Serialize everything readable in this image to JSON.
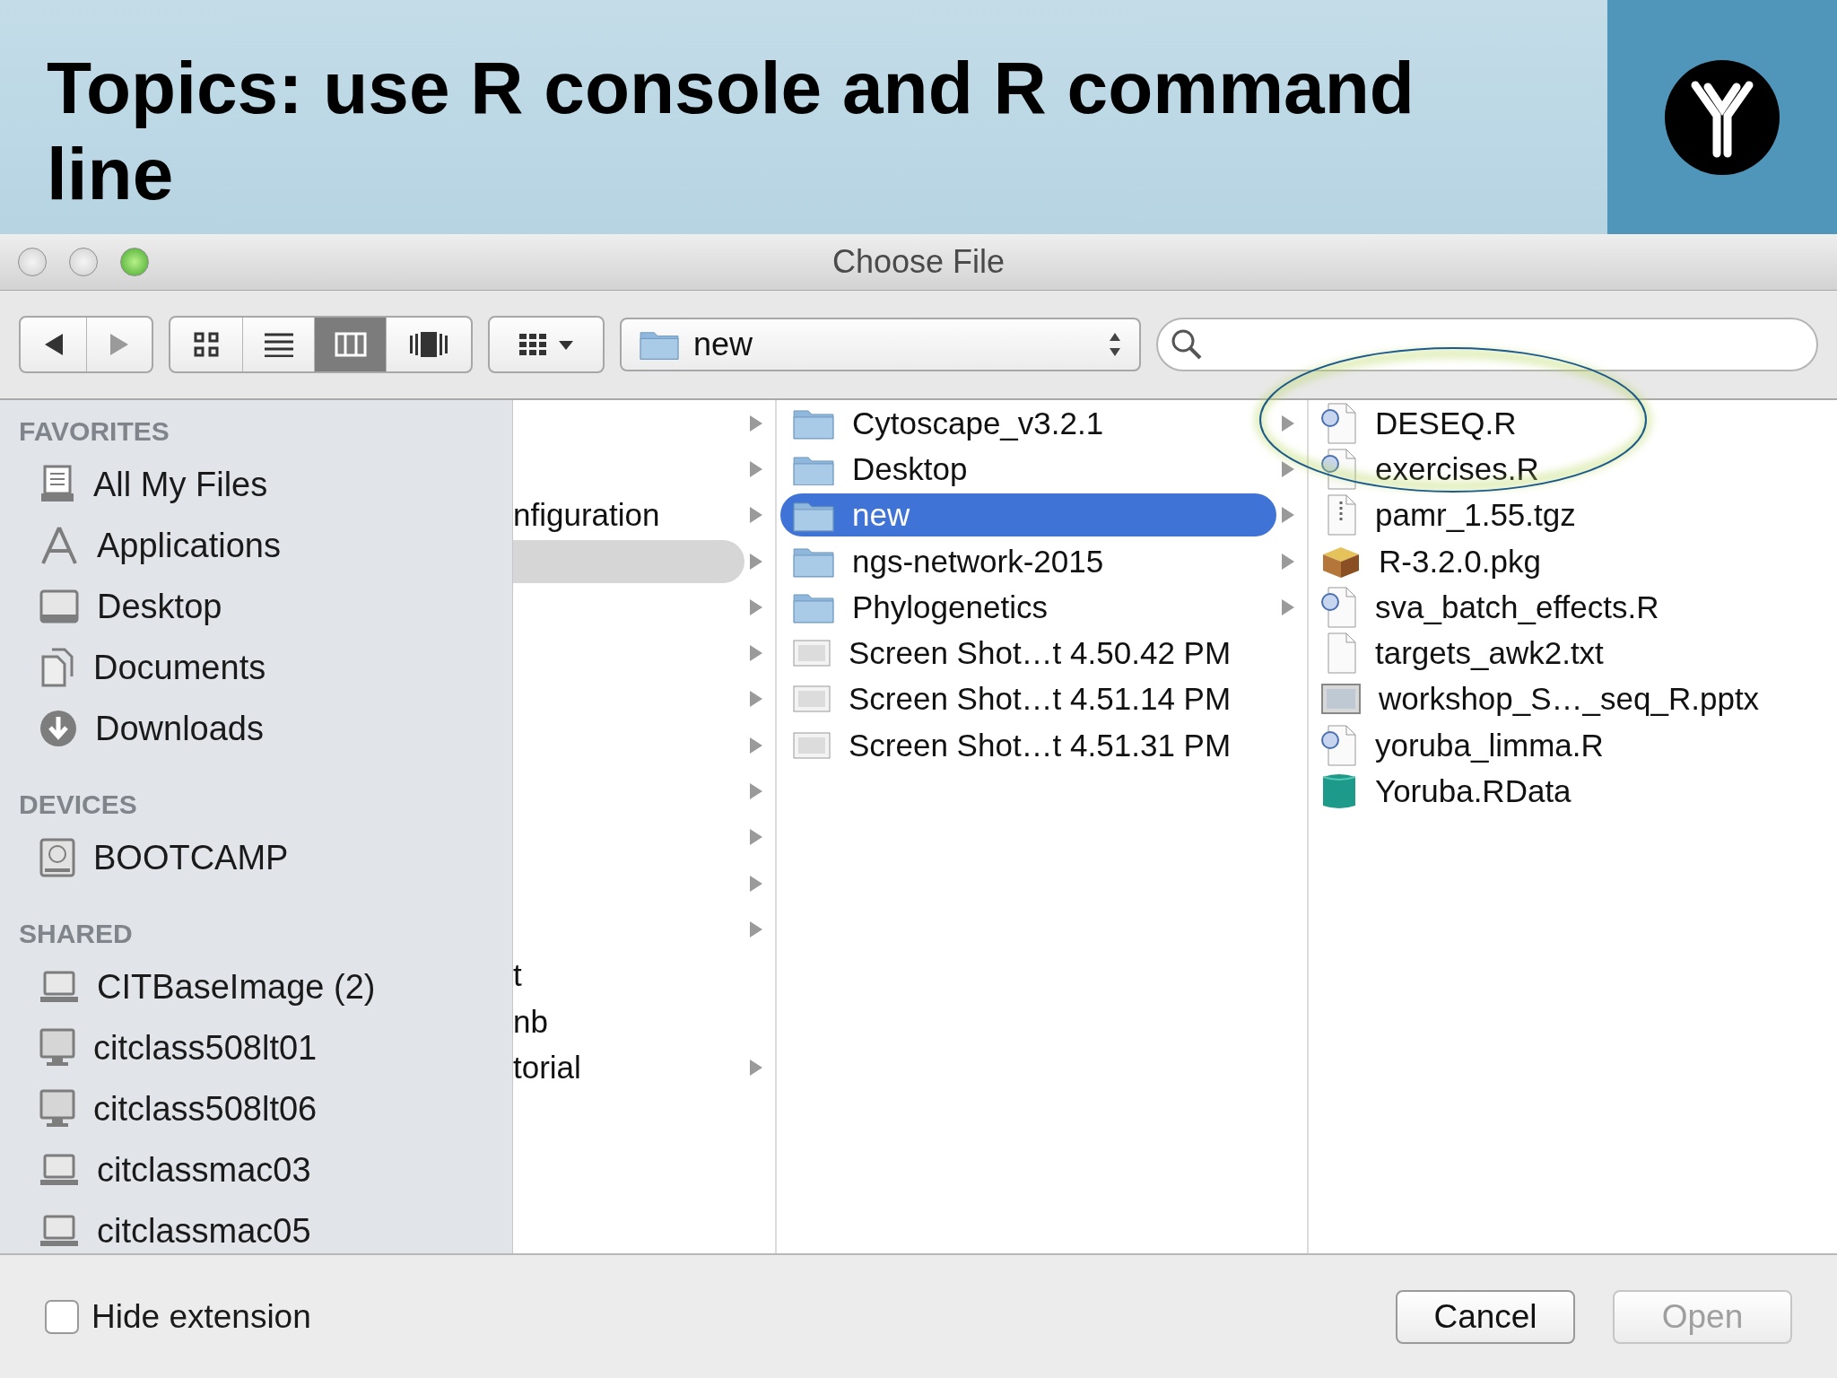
{
  "slide": {
    "title": "Topics: use R console and R command line"
  },
  "window": {
    "title": "Choose File"
  },
  "toolbar": {
    "views": [
      {
        "kind": "icons",
        "selected": false
      },
      {
        "kind": "list",
        "selected": false
      },
      {
        "kind": "columns",
        "selected": true
      },
      {
        "kind": "coverflow",
        "selected": false
      }
    ],
    "path": "new"
  },
  "sidebar": [
    {
      "heading": "FAVORITES",
      "items": [
        {
          "label": "All My Files",
          "kind": "files"
        },
        {
          "label": "Applications",
          "kind": "apps"
        },
        {
          "label": "Desktop",
          "kind": "desktop"
        },
        {
          "label": "Documents",
          "kind": "documents"
        },
        {
          "label": "Downloads",
          "kind": "downloads"
        }
      ]
    },
    {
      "heading": "DEVICES",
      "items": [
        {
          "label": "BOOTCAMP",
          "kind": "disk"
        }
      ]
    },
    {
      "heading": "SHARED",
      "items": [
        {
          "label": "CITBaseImage (2)",
          "kind": "laptop"
        },
        {
          "label": "citclass508lt01",
          "kind": "computer"
        },
        {
          "label": "citclass508lt06",
          "kind": "computer"
        },
        {
          "label": "citclassmac03",
          "kind": "laptop"
        },
        {
          "label": "citclassmac05",
          "kind": "laptop"
        }
      ]
    }
  ],
  "columns": [
    [
      {
        "has_children": true,
        "selected": false
      },
      {
        "has_children": true,
        "selected": false
      },
      {
        "label": "nfiguration",
        "has_children": true,
        "selected": false
      },
      {
        "has_children": true,
        "selected": true
      },
      {
        "has_children": true,
        "selected": false
      },
      {
        "has_children": true,
        "selected": false
      },
      {
        "has_children": true,
        "selected": false
      },
      {
        "has_children": true,
        "selected": false
      },
      {
        "has_children": true,
        "selected": false
      },
      {
        "has_children": true,
        "selected": false
      },
      {
        "has_children": true,
        "selected": false
      },
      {
        "has_children": true,
        "selected": false
      },
      {
        "label": "t",
        "has_children": false,
        "selected": false
      },
      {
        "label": "nb",
        "has_children": false,
        "selected": false
      },
      {
        "label": "torial",
        "has_children": true,
        "selected": false
      }
    ],
    [
      {
        "label": "Cytoscape_v3.2.1",
        "kind": "folder",
        "has_children": true,
        "selected": false
      },
      {
        "label": "Desktop",
        "kind": "folder",
        "has_children": true,
        "selected": false
      },
      {
        "label": "new",
        "kind": "folder",
        "has_children": true,
        "selected": true
      },
      {
        "label": "ngs-network-2015",
        "kind": "folder",
        "has_children": true,
        "selected": false
      },
      {
        "label": "Phylogenetics",
        "kind": "folder",
        "has_children": true,
        "selected": false
      },
      {
        "label": "Screen Shot…t 4.50.42 PM",
        "kind": "image",
        "has_children": false,
        "selected": false
      },
      {
        "label": "Screen Shot…t 4.51.14 PM",
        "kind": "image",
        "has_children": false,
        "selected": false
      },
      {
        "label": "Screen Shot…t 4.51.31 PM",
        "kind": "image",
        "has_children": false,
        "selected": false
      }
    ],
    [
      {
        "label": "DESEQ.R",
        "kind": "rscript",
        "has_children": false,
        "selected": false
      },
      {
        "label": "exercises.R",
        "kind": "rscript",
        "has_children": false,
        "selected": false
      },
      {
        "label": "pamr_1.55.tgz",
        "kind": "archive",
        "has_children": false,
        "selected": false
      },
      {
        "label": "R-3.2.0.pkg",
        "kind": "package",
        "has_children": false,
        "selected": false
      },
      {
        "label": "sva_batch_effects.R",
        "kind": "rscript",
        "has_children": false,
        "selected": false
      },
      {
        "label": "targets_awk2.txt",
        "kind": "text",
        "has_children": false,
        "selected": false
      },
      {
        "label": "workshop_S…_seq_R.pptx",
        "kind": "slides",
        "has_children": false,
        "selected": false
      },
      {
        "label": "yoruba_limma.R",
        "kind": "rscript",
        "has_children": false,
        "selected": false
      },
      {
        "label": "Yoruba.RData",
        "kind": "rdata",
        "has_children": false,
        "selected": false
      }
    ]
  ],
  "footer": {
    "hide_extension": {
      "label": "Hide extension",
      "checked": false
    },
    "buttons": [
      {
        "label": "Cancel",
        "disabled": false
      },
      {
        "label": "Open",
        "disabled": true
      }
    ]
  }
}
